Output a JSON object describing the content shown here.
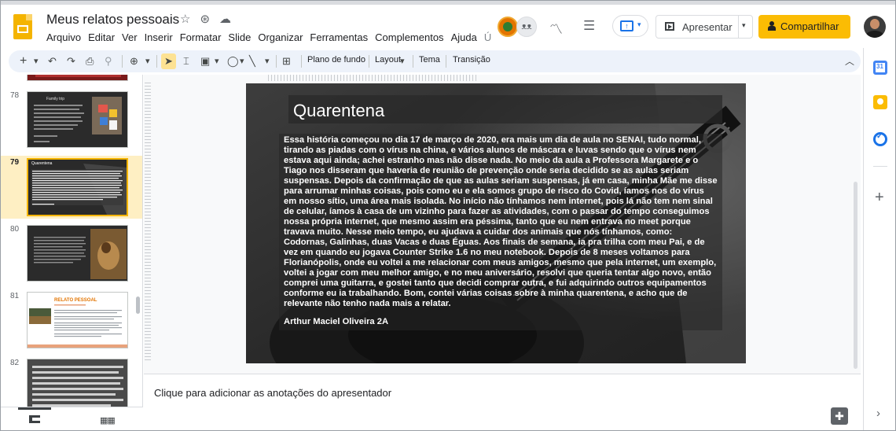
{
  "app": {
    "doc_title": "Meus relatos pessoais",
    "title_icons": [
      "star-icon",
      "move-to-folder-icon",
      "cloud-status-icon"
    ]
  },
  "menu": {
    "items": [
      "Arquivo",
      "Editar",
      "Ver",
      "Inserir",
      "Formatar",
      "Slide",
      "Organizar",
      "Ferramentas",
      "Complementos",
      "Ajuda"
    ],
    "last_edit_glyph": "Ú"
  },
  "header": {
    "collab_initials": "ᴥᴥ",
    "present_label": "Apresentar",
    "share_label": "Compartilhar",
    "share_color": "#fbbc04",
    "accent_color": "#1a73e8"
  },
  "toolbar": {
    "background_label": "Plano de fundo",
    "layout_label": "Layout",
    "theme_label": "Tema",
    "transition_label": "Transição",
    "new_slide_glyph": "+",
    "dropdown_glyph": "▾"
  },
  "filmstrip": {
    "slides": [
      {
        "number": "78",
        "selected": false
      },
      {
        "number": "79",
        "selected": true
      },
      {
        "number": "80",
        "selected": false
      },
      {
        "number": "81",
        "selected": false
      },
      {
        "number": "82",
        "selected": false
      }
    ],
    "thumb78_title": "Family trip",
    "thumb79_title": "Quarentena",
    "thumb81_title": "RELATO PESSOAL",
    "highlight_color": "#feefc3",
    "selected_border_color": "#f4b400"
  },
  "slide": {
    "title": "Quarentena",
    "body": "Essa história começou no dia 17 de março de 2020, era mais um dia de aula no SENAI, tudo normal, tirando as piadas com o vírus na china, e vários alunos de máscara e luvas sendo que o vírus nem estava aqui ainda; achei estranho mas não disse nada. No meio da aula a Professora Margarete e o Tiago nos disseram que haveria de reunião de prevenção onde seria decidido se as aulas seriam suspensas. Depois da confirmação de que as aulas seriam suspensas, já em casa, minha Mãe me disse para arrumar minhas coisas, pois como eu e ela somos grupo de risco do Covid, íamos nos do vírus em nosso sítio, uma área mais isolada. No início não tínhamos nem internet, pois lá não tem nem sinal de celular,  íamos à casa de um vizinho para fazer as atividades, com o passar do tempo conseguimos nossa própria internet, que mesmo assim era péssima, tanto  que eu nem entrava no meet porque travava muito. Nesse meio tempo, eu ajudava a cuidar dos animais que nós tínhamos, como: Codornas, Galinhas, duas Vacas e duas Éguas. Aos finais de semana, ia pra trilha com meu Pai, e de vez em quando eu jogava Counter Strike 1.6 no meu notebook. Depois de 8 meses voltamos para Florianópolis, onde eu voltei a me relacionar com meus amigos, mesmo que pela internet, um exemplo, voltei a jogar com meu melhor amigo, e no meu aniversário, resolvi que queria tentar algo novo, então comprei uma guitarra, e gostei tanto que decidi comprar outra, e fui adquirindo outros equipamentos conforme eu ia trabalhando. Bom, contei várias coisas sobre à minha quarentena, e acho que de relevante não tenho nada mais a relatar.",
    "author": "Arthur Maciel Oliveira 2A"
  },
  "notes": {
    "placeholder": "Clique para adicionar as anotações do apresentador"
  },
  "sidepanel": {
    "icons": [
      "calendar-icon",
      "keep-icon",
      "tasks-icon"
    ],
    "add_glyph": "+",
    "collapse_glyph": "›"
  }
}
